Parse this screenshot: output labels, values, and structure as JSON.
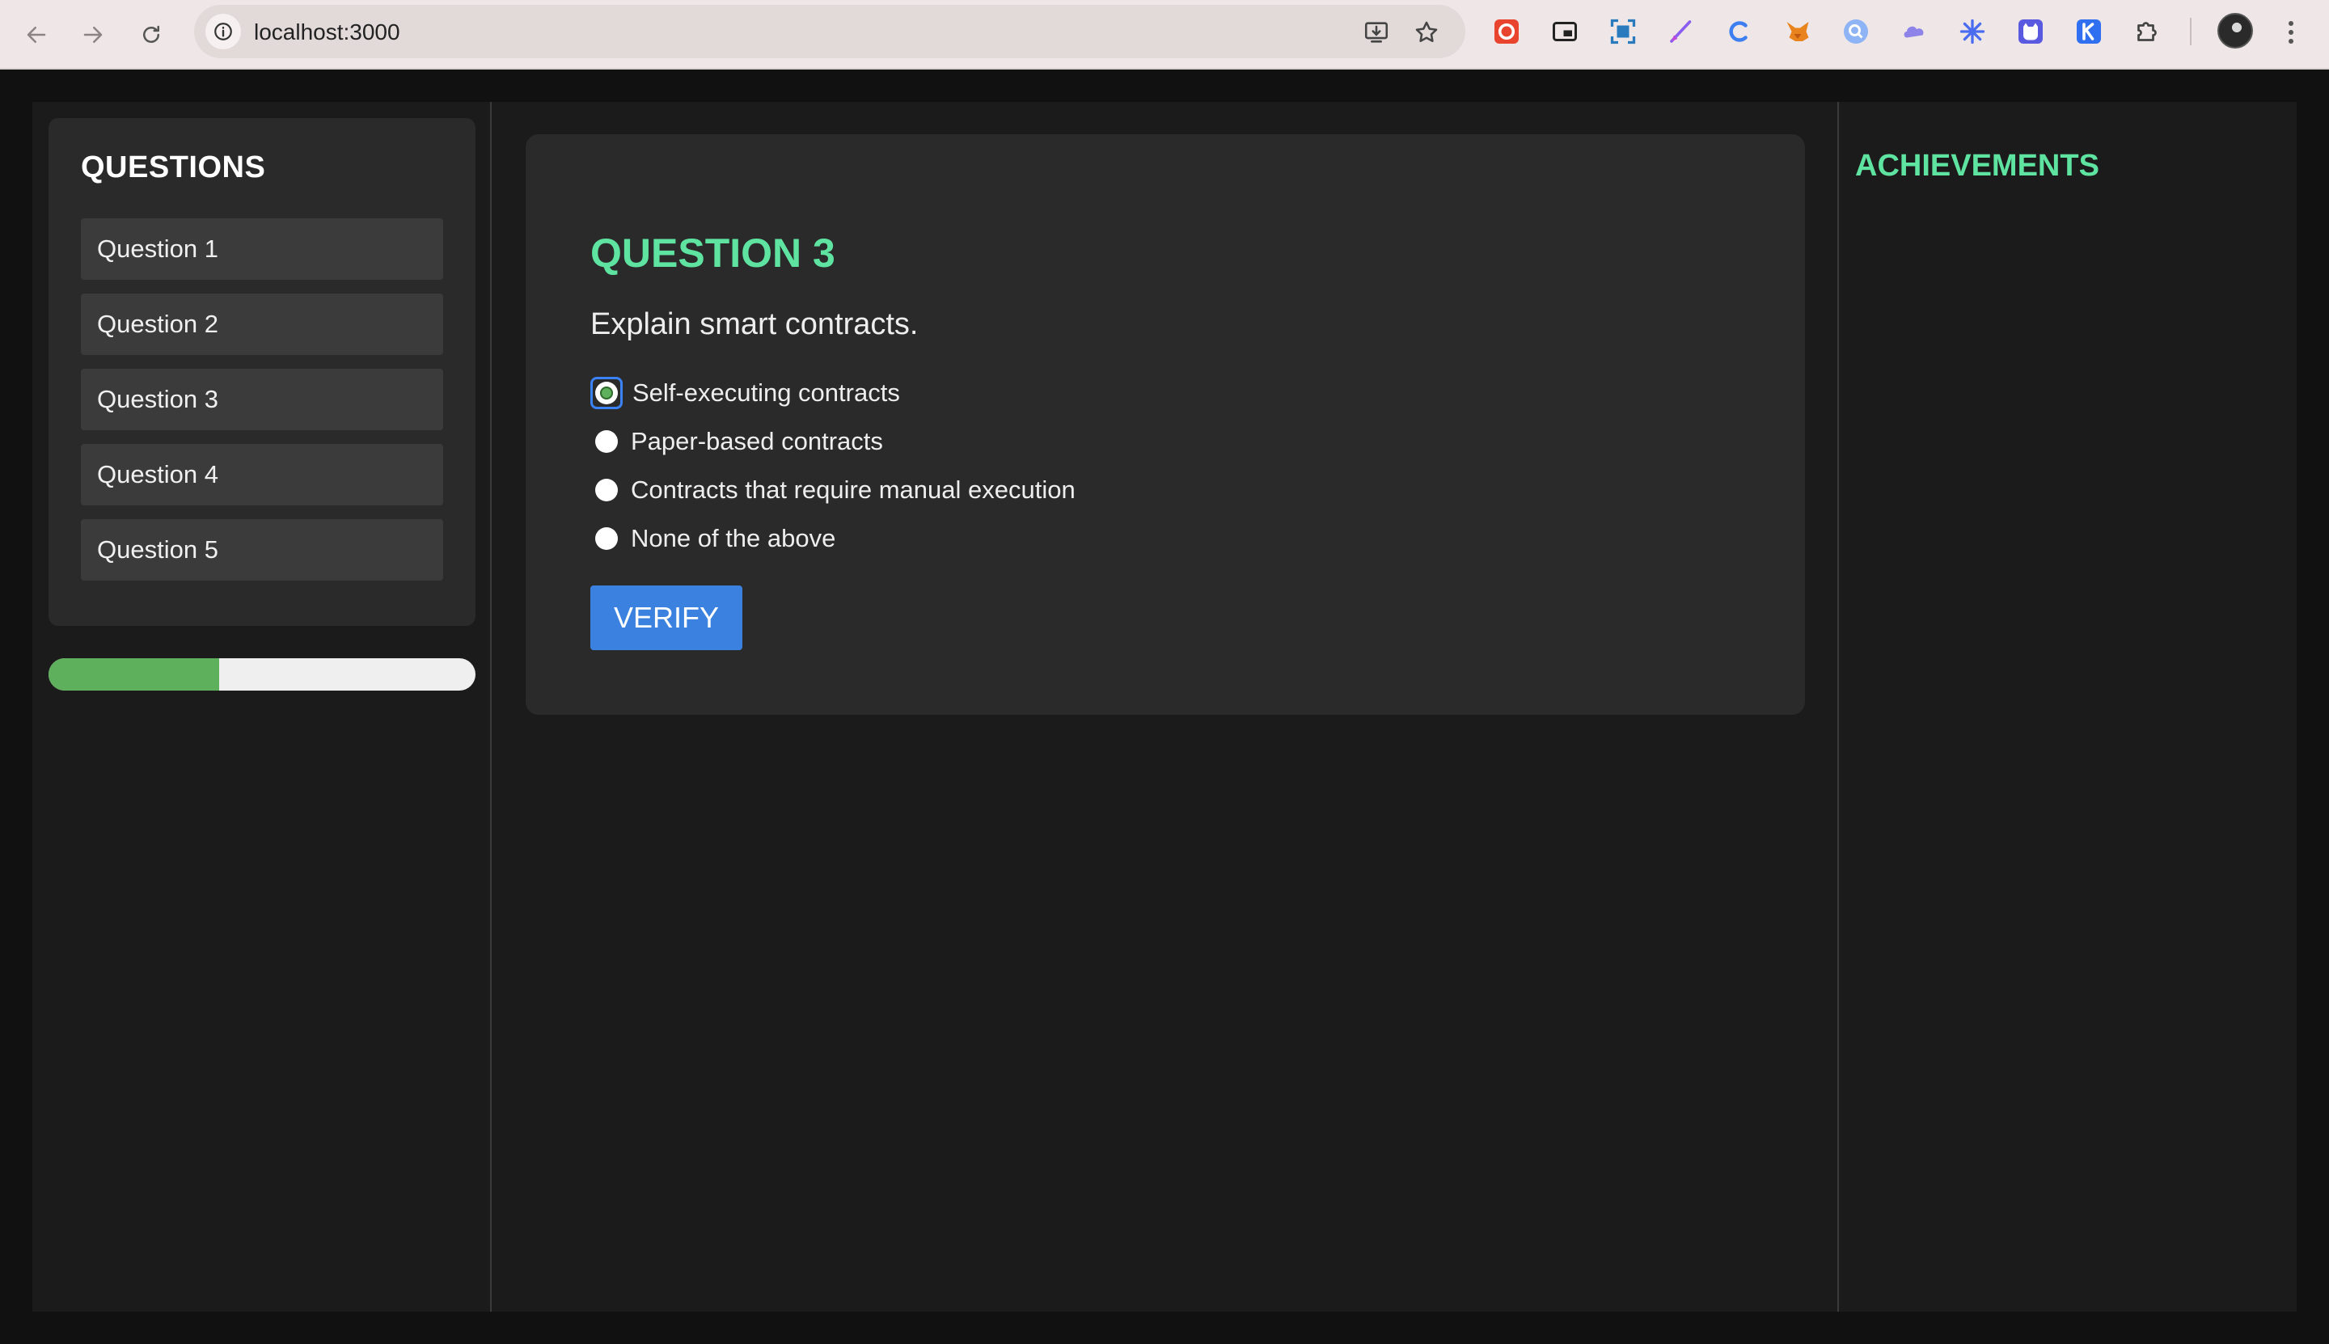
{
  "browser": {
    "url": "localhost:3000",
    "extensions": [
      "opera-icon",
      "picture-in-picture-icon",
      "screenshot-icon",
      "pen-icon",
      "c-extension-icon",
      "metamask-fox-icon",
      "search-lens-icon",
      "cloud-icon",
      "snowflake-icon",
      "cat-icon",
      "k-extension-icon",
      "puzzle-icon"
    ]
  },
  "sidebar": {
    "title": "QUESTIONS",
    "items": [
      {
        "label": "Question 1"
      },
      {
        "label": "Question 2"
      },
      {
        "label": "Question 3"
      },
      {
        "label": "Question 4"
      },
      {
        "label": "Question 5"
      }
    ],
    "progress_fraction": 0.4
  },
  "main": {
    "title": "QUESTION 3",
    "question": "Explain smart contracts.",
    "options": [
      {
        "label": "Self-executing contracts",
        "selected": true
      },
      {
        "label": "Paper-based contracts",
        "selected": false
      },
      {
        "label": "Contracts that require manual execution",
        "selected": false
      },
      {
        "label": "None of the above",
        "selected": false
      }
    ],
    "verify_label": "VERIFY"
  },
  "achievements": {
    "title": "ACHIEVEMENTS"
  },
  "colors": {
    "accent_green": "#5ee3a0",
    "progress_green": "#5fb05c",
    "button_blue": "#3b82e0"
  }
}
